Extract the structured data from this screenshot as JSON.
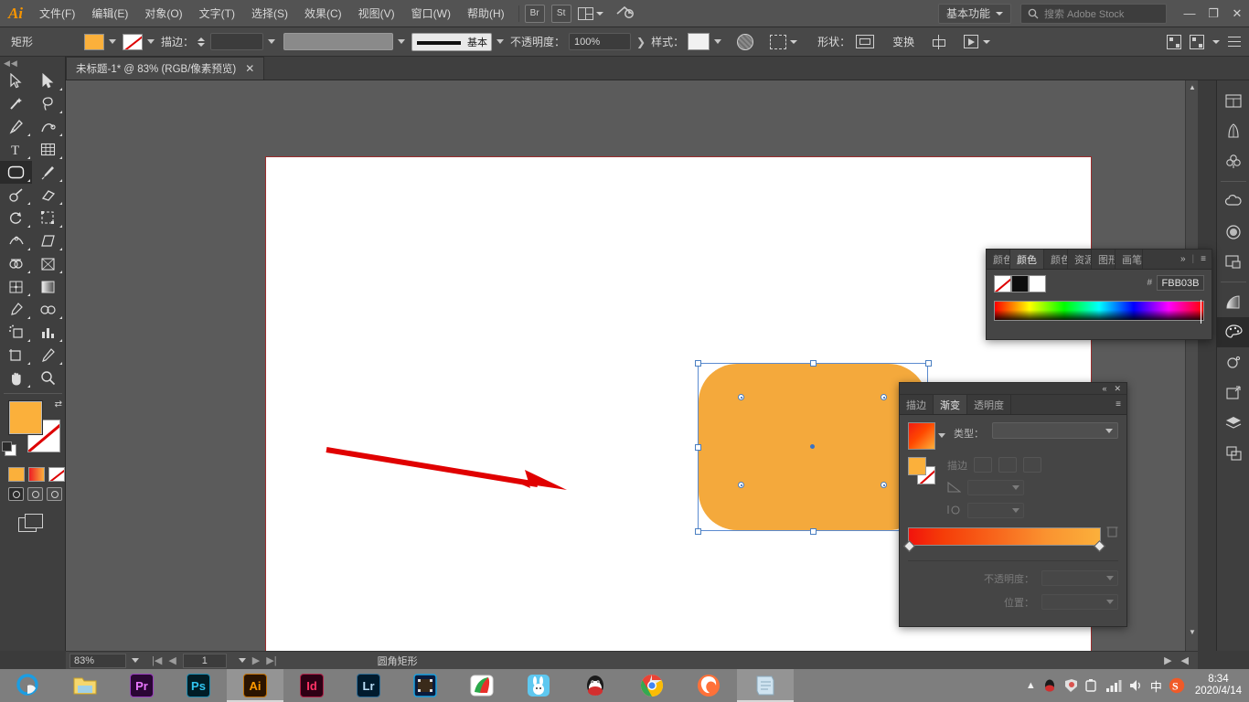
{
  "app": {
    "logo": "Ai",
    "menus": [
      {
        "label": "文件(F)"
      },
      {
        "label": "编辑(E)"
      },
      {
        "label": "对象(O)"
      },
      {
        "label": "文字(T)"
      },
      {
        "label": "选择(S)"
      },
      {
        "label": "效果(C)"
      },
      {
        "label": "视图(V)"
      },
      {
        "label": "窗口(W)"
      },
      {
        "label": "帮助(H)"
      }
    ],
    "launch_buttons": [
      {
        "label": "Br",
        "name": "bridge-button"
      },
      {
        "label": "St",
        "name": "stock-button"
      }
    ],
    "workspace": "基本功能",
    "stock_placeholder": "搜索 Adobe Stock",
    "window_controls": {
      "minimize": "—",
      "restore": "❐",
      "close": "✕"
    }
  },
  "options_bar": {
    "object_type": "矩形",
    "fill_color": "#fbb03b",
    "stroke_none": true,
    "stroke_label": "描边：",
    "stroke_weight": "",
    "profile_label": "基本",
    "opacity_label": "不透明度：",
    "opacity_value": "100%",
    "style_label": "样式：",
    "shape_label": "形状：",
    "transform_label": "变换"
  },
  "document_tab": {
    "title": "未标题-1* @ 83% (RGB/像素预览)",
    "close": "✕"
  },
  "toolbar": {
    "tools": [
      {
        "name": "selection-tool",
        "label": "选择工具"
      },
      {
        "name": "direct-selection-tool",
        "label": "直接选择工具"
      },
      {
        "name": "magic-wand-tool",
        "label": "魔棒工具"
      },
      {
        "name": "lasso-tool",
        "label": "套索工具"
      },
      {
        "name": "pen-tool",
        "label": "钢笔工具"
      },
      {
        "name": "curvature-tool",
        "label": "曲率工具"
      },
      {
        "name": "type-tool",
        "label": "文字工具"
      },
      {
        "name": "line-segment-tool",
        "label": "直线段工具"
      },
      {
        "name": "rectangle-tool",
        "label": "矩形工具",
        "active": true
      },
      {
        "name": "paintbrush-tool",
        "label": "画笔工具"
      },
      {
        "name": "shaper-tool",
        "label": "Shaper 工具"
      },
      {
        "name": "eraser-tool",
        "label": "橡皮擦工具"
      },
      {
        "name": "rotate-tool",
        "label": "旋转工具"
      },
      {
        "name": "scale-tool",
        "label": "比例缩放工具"
      },
      {
        "name": "width-tool",
        "label": "宽度工具"
      },
      {
        "name": "free-transform-tool",
        "label": "自由变换工具"
      },
      {
        "name": "shape-builder-tool",
        "label": "形状生成器工具"
      },
      {
        "name": "perspective-grid-tool",
        "label": "透视网格工具"
      },
      {
        "name": "mesh-tool",
        "label": "网格工具"
      },
      {
        "name": "gradient-tool",
        "label": "渐变工具"
      },
      {
        "name": "eyedropper-tool",
        "label": "吸管工具"
      },
      {
        "name": "blend-tool",
        "label": "混合工具"
      },
      {
        "name": "symbol-sprayer-tool",
        "label": "符号喷枪工具"
      },
      {
        "name": "column-graph-tool",
        "label": "柱形图工具"
      },
      {
        "name": "artboard-tool",
        "label": "画板工具"
      },
      {
        "name": "slice-tool",
        "label": "切片工具"
      },
      {
        "name": "hand-tool",
        "label": "抓手工具"
      },
      {
        "name": "zoom-tool",
        "label": "缩放工具"
      }
    ],
    "fill_color": "#fbb03b",
    "stroke_color": "none",
    "fill_modes": [
      {
        "name": "flat-color-mode"
      },
      {
        "name": "gradient-mode"
      },
      {
        "name": "none-mode"
      }
    ],
    "screen_modes": [
      {
        "name": "normal-screen-mode",
        "active": true
      },
      {
        "name": "full-screen-menu-mode"
      },
      {
        "name": "full-screen-mode"
      }
    ]
  },
  "canvas": {
    "artboard_background": "#ffffff",
    "shape": {
      "name": "rounded-rectangle",
      "fill": "#f4a93c",
      "selected": true
    },
    "annotation": {
      "type": "arrow",
      "color": "#e00000"
    }
  },
  "status_bar": {
    "zoom": "83%",
    "page": "1",
    "tool_name": "圆角矩形"
  },
  "color_panel": {
    "tabs": [
      {
        "label": "颜色参考",
        "active": false
      },
      {
        "label": "颜色",
        "active": true
      },
      {
        "label": "颜色",
        "active": false
      },
      {
        "label": "资源",
        "active": false
      },
      {
        "label": "图形",
        "active": false
      },
      {
        "label": "画笔",
        "active": false
      }
    ],
    "hash": "#",
    "hex": "FBB03B",
    "swatches": [
      "none",
      "#0d0d0d",
      "#ffffff"
    ],
    "overflow": "»",
    "menu": "≡"
  },
  "gradient_panel": {
    "tabs": [
      {
        "label": "描边",
        "active": false
      },
      {
        "label": "渐变",
        "active": true
      },
      {
        "label": "透明度",
        "active": false
      }
    ],
    "collapse": "«",
    "close": "✕",
    "menu": "≡",
    "type_label": "类型：",
    "type_value": "",
    "stroke_label": "描边",
    "angle_label": "角度",
    "aspect_label": "长宽比",
    "opacity_label": "不透明度：",
    "opacity_value": "",
    "location_label": "位置：",
    "location_value": "",
    "gradient_start": "#f2130c",
    "gradient_end": "#fbb03b"
  },
  "right_dock": {
    "items": [
      {
        "name": "libraries-icon"
      },
      {
        "name": "brushes-icon"
      },
      {
        "name": "symbols-icon"
      },
      {
        "name": "creative-cloud-icon"
      },
      {
        "name": "swatches-icon"
      },
      {
        "name": "artboards-icon"
      },
      {
        "name": "gradient-dock-icon"
      },
      {
        "name": "color-dock-icon",
        "active": true
      },
      {
        "name": "appearance-icon"
      },
      {
        "name": "transform-icon"
      },
      {
        "name": "layers-icon"
      },
      {
        "name": "pathfinder-icon"
      }
    ]
  },
  "taskbar": {
    "items": [
      {
        "name": "edge-browser",
        "label": "",
        "color": "#1b9de2"
      },
      {
        "name": "file-explorer",
        "label": "",
        "color": "#f5d76e"
      },
      {
        "name": "premiere-pro",
        "label": "Pr",
        "color": "#2a0634",
        "text": "#ea77ff"
      },
      {
        "name": "photoshop",
        "label": "Ps",
        "color": "#001d26",
        "text": "#31c5f0"
      },
      {
        "name": "illustrator",
        "label": "Ai",
        "color": "#2b1400",
        "text": "#ff9a00",
        "active": true
      },
      {
        "name": "indesign",
        "label": "Id",
        "color": "#2d0014",
        "text": "#ff3366"
      },
      {
        "name": "lightroom",
        "label": "Lr",
        "color": "#001b2e",
        "text": "#b9dcf5"
      },
      {
        "name": "media-player",
        "label": "",
        "color": "#0a1b3d"
      },
      {
        "name": "thunder-download",
        "label": "",
        "color": "#ffffff"
      },
      {
        "name": "rabbit-app",
        "label": "",
        "color": "#5ec8f0"
      },
      {
        "name": "qq-messenger",
        "label": "",
        "color": "#1b1b1b"
      },
      {
        "name": "chrome-browser",
        "label": "",
        "color": "#ffffff"
      },
      {
        "name": "firefox-browser",
        "label": "",
        "color": "#ff7139"
      },
      {
        "name": "notepad-app",
        "label": "",
        "color": "#cfe3f0",
        "active": true
      }
    ],
    "tray": {
      "ime": "中",
      "time": "8:34",
      "date": "2020/4/14"
    }
  }
}
